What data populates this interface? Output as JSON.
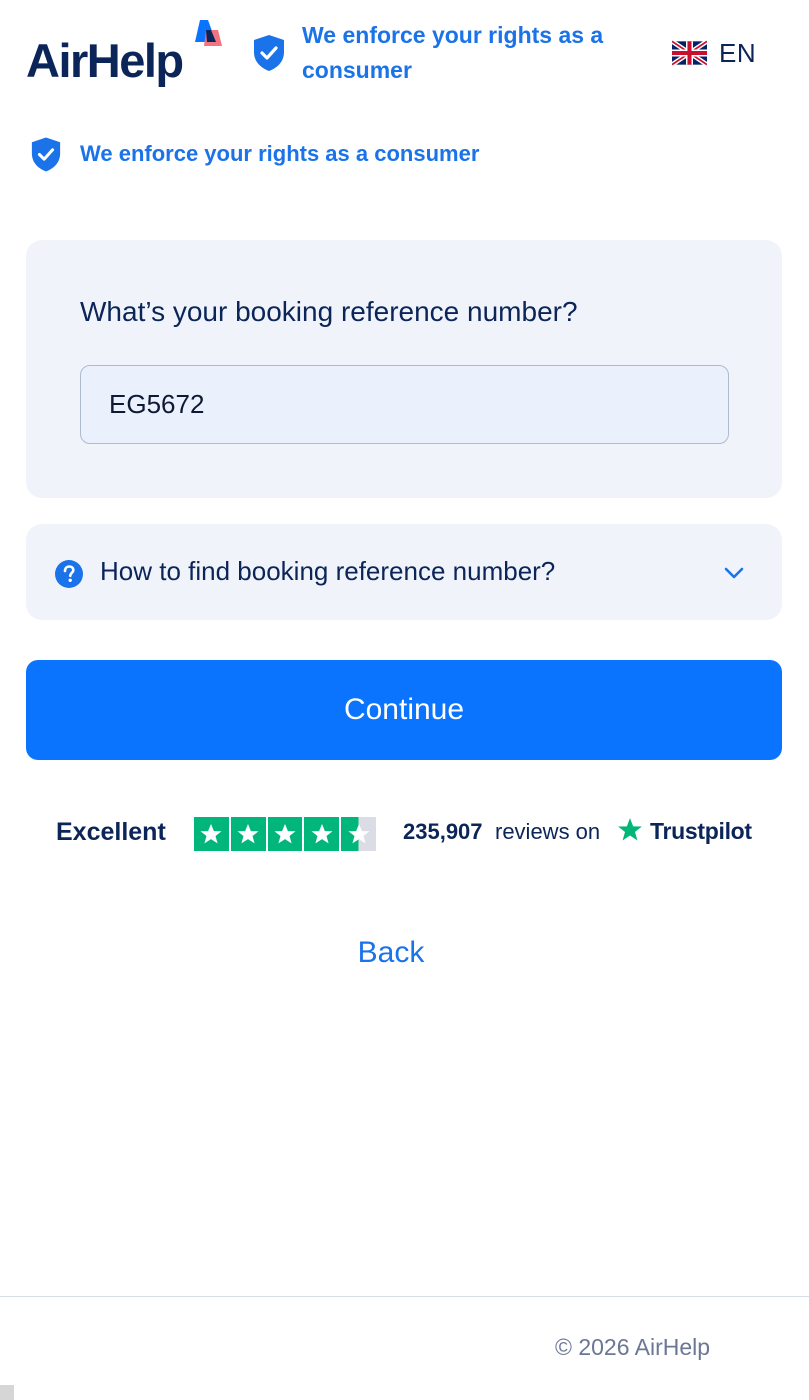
{
  "header": {
    "logo_text": "AirHelp",
    "badge_text": "We enforce your rights as a consumer",
    "language": "EN",
    "language_icon": "uk-flag-icon"
  },
  "subheader": {
    "badge_text": "We enforce your rights as a consumer",
    "icon": "shield-check-icon"
  },
  "booking": {
    "question": "What’s your booking reference number?",
    "input_value": "EG5672"
  },
  "help": {
    "label": "How to find booking reference number?",
    "icon": "question-circle-icon",
    "toggle_icon": "chevron-down-icon"
  },
  "continue_label": "Continue",
  "trustpilot": {
    "rating_label": "Excellent",
    "stars": 4.5,
    "review_count": "235,907",
    "reviews_text": "reviews on",
    "brand": "Trustpilot"
  },
  "back_label": "Back",
  "footer": {
    "copyright": "© 2026 AirHelp"
  },
  "colors": {
    "primary_blue": "#0b74ff",
    "link_blue": "#1a73e8",
    "navy_text": "#0b2559",
    "card_bg": "#f0f4fa",
    "trustpilot_green": "#00b67a"
  }
}
